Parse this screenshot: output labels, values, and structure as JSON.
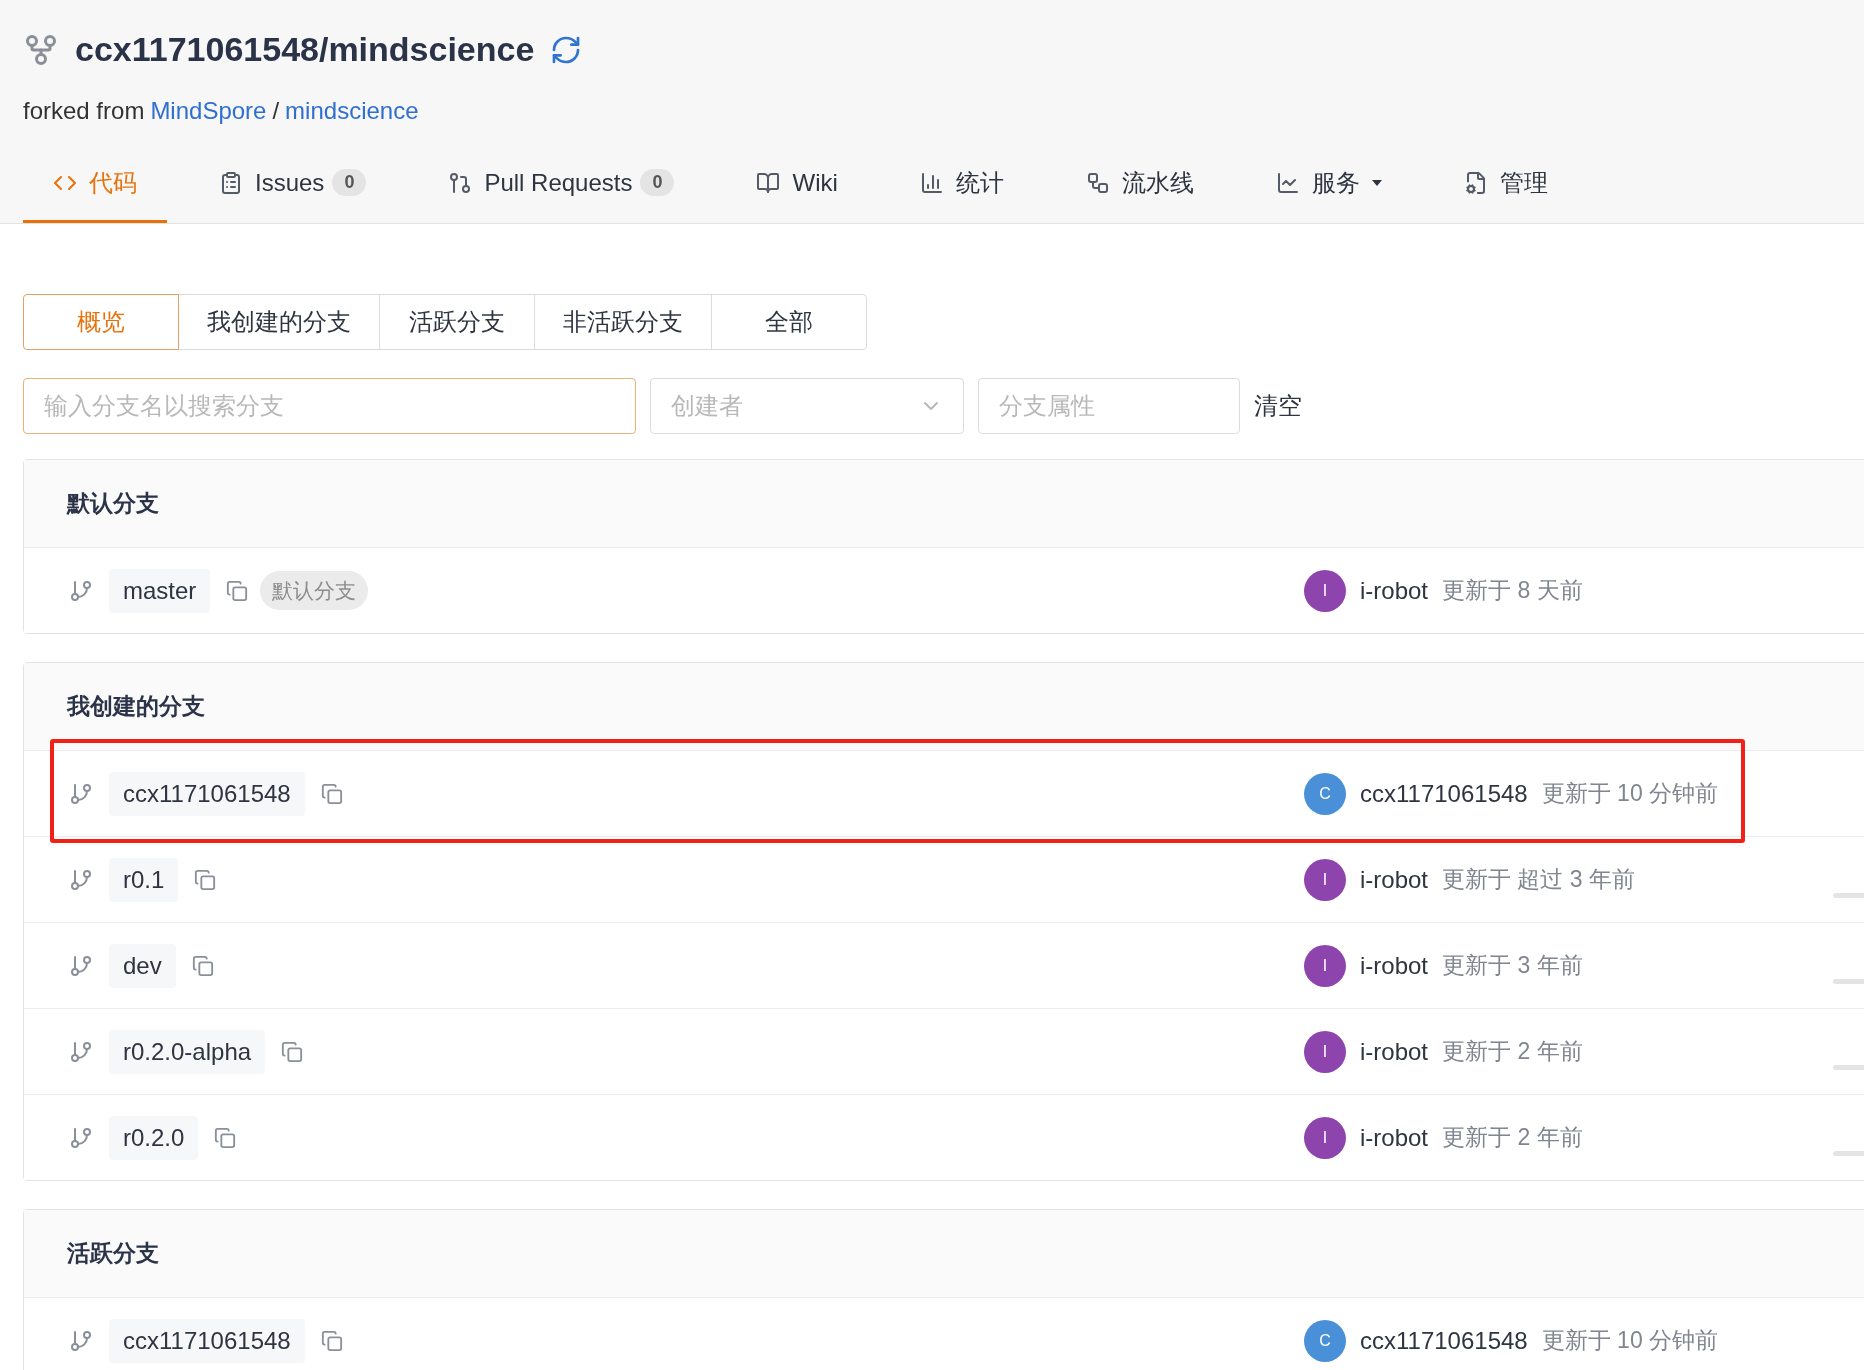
{
  "repo": {
    "title": "ccx1171061548/mindscience",
    "forked_prefix": "forked from",
    "fork_owner": "MindSpore",
    "fork_separator": "/",
    "fork_repo": "mindscience"
  },
  "nav_tabs": [
    {
      "kind": "code",
      "label": "代码",
      "selected": true
    },
    {
      "kind": "issues",
      "label": "Issues",
      "count": "0",
      "selected": false
    },
    {
      "kind": "pulls",
      "label": "Pull Requests",
      "count": "0",
      "selected": false
    },
    {
      "kind": "wiki",
      "label": "Wiki",
      "selected": false
    },
    {
      "kind": "stats",
      "label": "统计",
      "selected": false
    },
    {
      "kind": "pipeline",
      "label": "流水线",
      "selected": false
    },
    {
      "kind": "services",
      "label": "服务",
      "dropdown": true,
      "selected": false
    },
    {
      "kind": "manage",
      "label": "管理",
      "selected": false
    }
  ],
  "filter_tabs": [
    {
      "label": "概览",
      "selected": true
    },
    {
      "label": "我创建的分支",
      "selected": false
    },
    {
      "label": "活跃分支",
      "selected": false
    },
    {
      "label": "非活跃分支",
      "selected": false
    },
    {
      "label": "全部",
      "selected": false
    }
  ],
  "search": {
    "placeholder": "输入分支名以搜索分支"
  },
  "creator_select": {
    "placeholder": "创建者"
  },
  "attribute_field": {
    "placeholder": "分支属性"
  },
  "clear_button": "清空",
  "sections": [
    {
      "title": "默认分支",
      "branches": [
        {
          "name": "master",
          "badge": "默认分支",
          "avatar": "I",
          "color": "#8e44ad",
          "author": "i-robot",
          "updated": "更新于 8 天前",
          "highlighted": false,
          "trailing_bar": false
        }
      ]
    },
    {
      "title": "我创建的分支",
      "branches": [
        {
          "name": "ccx1171061548",
          "avatar": "C",
          "color": "#4a90d9",
          "author": "ccx1171061548",
          "updated": "更新于 10 分钟前",
          "highlighted": true,
          "trailing_bar": false
        },
        {
          "name": "r0.1",
          "avatar": "I",
          "color": "#8e44ad",
          "author": "i-robot",
          "updated": "更新于 超过 3 年前",
          "highlighted": false,
          "trailing_bar": true
        },
        {
          "name": "dev",
          "avatar": "I",
          "color": "#8e44ad",
          "author": "i-robot",
          "updated": "更新于 3 年前",
          "highlighted": false,
          "trailing_bar": true
        },
        {
          "name": "r0.2.0-alpha",
          "avatar": "I",
          "color": "#8e44ad",
          "author": "i-robot",
          "updated": "更新于 2 年前",
          "highlighted": false,
          "trailing_bar": true
        },
        {
          "name": "r0.2.0",
          "avatar": "I",
          "color": "#8e44ad",
          "author": "i-robot",
          "updated": "更新于 2 年前",
          "highlighted": false,
          "trailing_bar": true
        }
      ]
    },
    {
      "title": "活跃分支",
      "branches": [
        {
          "name": "ccx1171061548",
          "avatar": "C",
          "color": "#4a90d9",
          "author": "ccx1171061548",
          "updated": "更新于 10 分钟前",
          "highlighted": false,
          "trailing_bar": false
        }
      ]
    }
  ]
}
